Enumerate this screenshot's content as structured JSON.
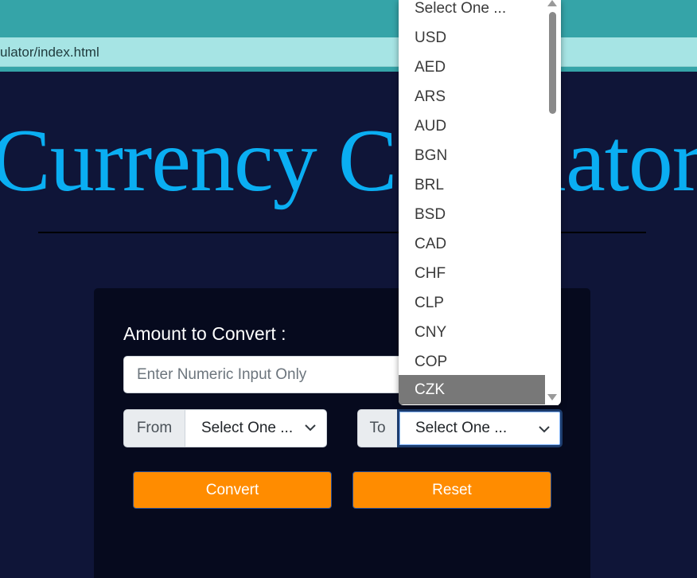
{
  "browser": {
    "url": "ulator/index.html"
  },
  "page": {
    "title": "Currency Calculator"
  },
  "form": {
    "amount_label": "Amount to Convert :",
    "amount_placeholder": "Enter Numeric Input Only",
    "from_label": "From",
    "from_value": "Select One ...",
    "to_label": "To",
    "to_value": "Select One ...",
    "convert_label": "Convert",
    "reset_label": "Reset"
  },
  "dropdown": {
    "options": [
      "Select One ...",
      "USD",
      "AED",
      "ARS",
      "AUD",
      "BGN",
      "BRL",
      "BSD",
      "CAD",
      "CHF",
      "CLP",
      "CNY",
      "COP",
      "CZK"
    ],
    "highlighted": "CZK"
  },
  "colors": {
    "title": "#0aaef2",
    "background": "#0f1538",
    "card": "#060a1e",
    "button": "#ff8c00",
    "browser_chrome": "#35a4a8"
  },
  "icons": {
    "select_arrow": "chevron-down-icon"
  }
}
